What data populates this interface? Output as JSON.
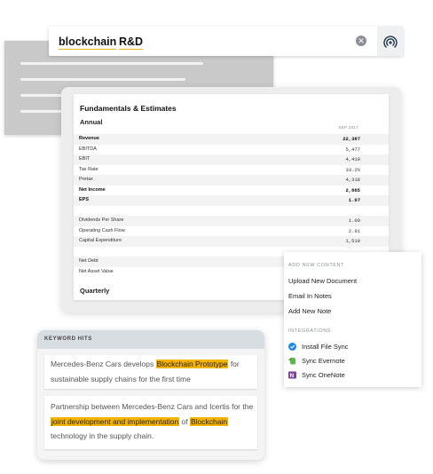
{
  "search": {
    "tokens": [
      "blockchain",
      "R&D"
    ],
    "clear_icon": "clear-icon",
    "voice_icon": "signal-icon"
  },
  "fundamentals": {
    "title": "Fundamentals & Estimates",
    "annual_label": "Annual",
    "column_header": "SEP 2017",
    "rows": [
      {
        "label": "Revenue",
        "value": "22,387"
      },
      {
        "label": "EBITDA",
        "value": "5,477"
      },
      {
        "label": "EBIT",
        "value": "4,410"
      },
      {
        "label": "Tax Rate",
        "value": "33.2%"
      },
      {
        "label": "Pretax",
        "value": "4,318"
      },
      {
        "label": "Net Income",
        "value": "2,885"
      },
      {
        "label": "EPS",
        "value": "1.07"
      },
      {
        "label": "Dividends Per Share",
        "value": "1.00"
      },
      {
        "label": "Operating Cash Flow",
        "value": "2.91"
      },
      {
        "label": "Capital Expenditure",
        "value": "1,519"
      },
      {
        "label": "Net Debt",
        "value": ""
      },
      {
        "label": "Net Asset Value",
        "value": ""
      }
    ],
    "quarterly_label": "Quarterly"
  },
  "add_menu": {
    "header": "ADD NEW CONTENT",
    "items": [
      "Upload New Document",
      "Email In Notes",
      "Add New Note"
    ],
    "integrations_header": "INTEGRATIONS",
    "integrations": [
      {
        "label": "Install File Sync",
        "icon": "file-sync-icon",
        "color": "#1e88e5"
      },
      {
        "label": "Sync Evernote",
        "icon": "evernote-icon",
        "color": "#5bb748"
      },
      {
        "label": "Sync OneNote",
        "icon": "onenote-icon",
        "color": "#7b3f9e"
      }
    ]
  },
  "keyword_hits": {
    "header": "KEYWORD HITS",
    "hit1": {
      "pre": "Mercedes-Benz Cars develops ",
      "highlight": "Blockchain Prototype",
      "post": " for sustainable supply chains for the first time"
    },
    "hit2": {
      "pre": "Partnership between Mercedes-Benz Cars and Icertis for the ",
      "highlight1": "joint development and implementation",
      "mid": " of ",
      "highlight2": "Blockchain",
      "post": " technology in the supply chain."
    }
  },
  "colors": {
    "highlight": "#f5b400",
    "underline": "#e8b51a"
  }
}
